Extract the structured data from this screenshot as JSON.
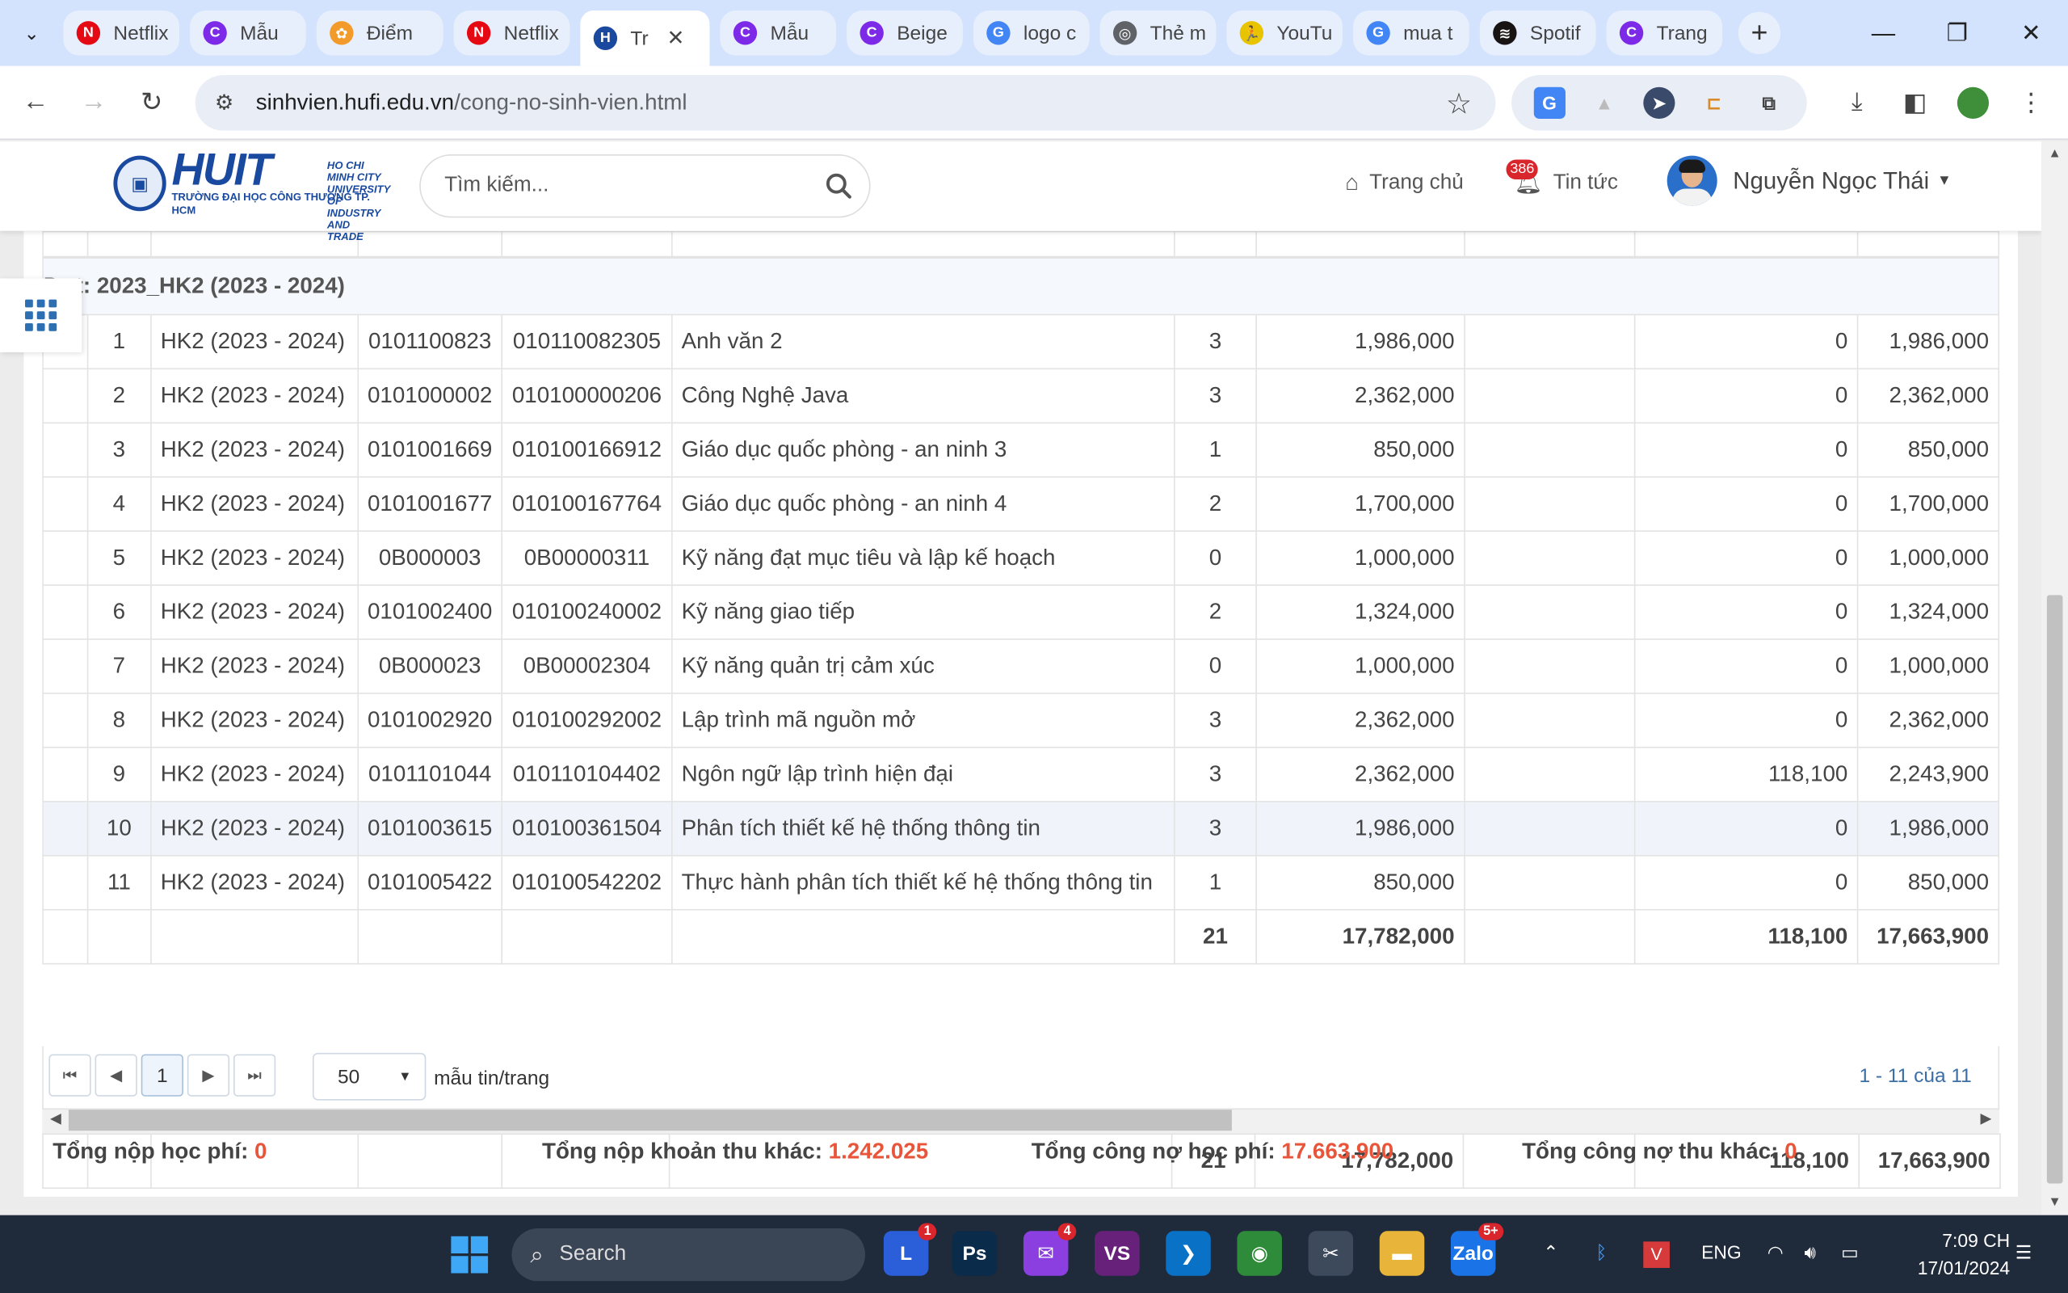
{
  "browser": {
    "tabs": [
      {
        "label": "Netflix",
        "icon": "netflix-icon",
        "color": "#e50914",
        "glyph": "N"
      },
      {
        "label": "Mẫu",
        "icon": "canva-icon",
        "color": "#7d2ae8",
        "glyph": "C"
      },
      {
        "label": "Điểm",
        "icon": "settings-flower-icon",
        "color": "#f29b2b",
        "glyph": "✿"
      },
      {
        "label": "Netflix",
        "icon": "netflix-icon",
        "color": "#e50914",
        "glyph": "N"
      },
      {
        "label": "Tr",
        "icon": "huit-icon",
        "color": "#1a4aa0",
        "glyph": "H",
        "active": true
      },
      {
        "label": "Mẫu",
        "icon": "canva-icon",
        "color": "#7d2ae8",
        "glyph": "C"
      },
      {
        "label": "Beige",
        "icon": "canva-icon",
        "color": "#7d2ae8",
        "glyph": "C"
      },
      {
        "label": "logo c",
        "icon": "google-icon",
        "color": "#4285f4",
        "glyph": "G"
      },
      {
        "label": "Thẻ m",
        "icon": "chrome-icon",
        "color": "#5f6368",
        "glyph": "◎"
      },
      {
        "label": "YouTu",
        "icon": "run-icon",
        "color": "#e8c300",
        "glyph": "🏃"
      },
      {
        "label": "mua t",
        "icon": "google-icon",
        "color": "#4285f4",
        "glyph": "G"
      },
      {
        "label": "Spotif",
        "icon": "spotify-icon",
        "color": "#191414",
        "glyph": "≋"
      },
      {
        "label": "Trang",
        "icon": "canva-icon",
        "color": "#7d2ae8",
        "glyph": "C"
      }
    ],
    "url_host": "sinhvien.hufi.edu.vn",
    "url_path": "/cong-no-sinh-vien.html"
  },
  "site": {
    "logo_text": "HUIT",
    "logo_sub": "TRƯỜNG ĐẠI HỌC CÔNG THƯƠNG TP. HCM",
    "logo_side": "HO CHI MINH CITY UNIVERSITY OF INDUSTRY AND TRADE",
    "search_placeholder": "Tìm kiếm...",
    "nav_home": "Trang chủ",
    "nav_news": "Tin tức",
    "news_badge": "386",
    "user_name": "Nguyễn Ngọc Thái"
  },
  "table": {
    "group_label": "Đợt: 2023_HK2 (2023 - 2024)",
    "rows": [
      {
        "stt": "1",
        "hk": "HK2 (2023 - 2024)",
        "ma_mh": "0101100823",
        "ma_lhp": "010110082305",
        "ten": "Anh văn 2",
        "tc": "3",
        "so_tien": "1,986,000",
        "mien_giam": "",
        "khau_tru": "0",
        "cong_no": "1,986,000"
      },
      {
        "stt": "2",
        "hk": "HK2 (2023 - 2024)",
        "ma_mh": "0101000002",
        "ma_lhp": "010100000206",
        "ten": "Công Nghệ Java",
        "tc": "3",
        "so_tien": "2,362,000",
        "mien_giam": "",
        "khau_tru": "0",
        "cong_no": "2,362,000"
      },
      {
        "stt": "3",
        "hk": "HK2 (2023 - 2024)",
        "ma_mh": "0101001669",
        "ma_lhp": "010100166912",
        "ten": "Giáo dục quốc phòng - an ninh 3",
        "tc": "1",
        "so_tien": "850,000",
        "mien_giam": "",
        "khau_tru": "0",
        "cong_no": "850,000"
      },
      {
        "stt": "4",
        "hk": "HK2 (2023 - 2024)",
        "ma_mh": "0101001677",
        "ma_lhp": "010100167764",
        "ten": "Giáo dục quốc phòng - an ninh 4",
        "tc": "2",
        "so_tien": "1,700,000",
        "mien_giam": "",
        "khau_tru": "0",
        "cong_no": "1,700,000"
      },
      {
        "stt": "5",
        "hk": "HK2 (2023 - 2024)",
        "ma_mh": "0B000003",
        "ma_lhp": "0B00000311",
        "ten": "Kỹ năng đạt mục tiêu và lập kế hoạch",
        "tc": "0",
        "so_tien": "1,000,000",
        "mien_giam": "",
        "khau_tru": "0",
        "cong_no": "1,000,000"
      },
      {
        "stt": "6",
        "hk": "HK2 (2023 - 2024)",
        "ma_mh": "0101002400",
        "ma_lhp": "010100240002",
        "ten": "Kỹ năng giao tiếp",
        "tc": "2",
        "so_tien": "1,324,000",
        "mien_giam": "",
        "khau_tru": "0",
        "cong_no": "1,324,000"
      },
      {
        "stt": "7",
        "hk": "HK2 (2023 - 2024)",
        "ma_mh": "0B000023",
        "ma_lhp": "0B00002304",
        "ten": "Kỹ năng quản trị cảm xúc",
        "tc": "0",
        "so_tien": "1,000,000",
        "mien_giam": "",
        "khau_tru": "0",
        "cong_no": "1,000,000"
      },
      {
        "stt": "8",
        "hk": "HK2 (2023 - 2024)",
        "ma_mh": "0101002920",
        "ma_lhp": "010100292002",
        "ten": "Lập trình mã nguồn mở",
        "tc": "3",
        "so_tien": "2,362,000",
        "mien_giam": "",
        "khau_tru": "0",
        "cong_no": "2,362,000"
      },
      {
        "stt": "9",
        "hk": "HK2 (2023 - 2024)",
        "ma_mh": "0101101044",
        "ma_lhp": "010110104402",
        "ten": "Ngôn ngữ lập trình hiện đại",
        "tc": "3",
        "so_tien": "2,362,000",
        "mien_giam": "",
        "khau_tru": "118,100",
        "cong_no": "2,243,900"
      },
      {
        "stt": "10",
        "hk": "HK2 (2023 - 2024)",
        "ma_mh": "0101003615",
        "ma_lhp": "010100361504",
        "ten": "Phân tích thiết kế hệ thống thông tin",
        "tc": "3",
        "so_tien": "1,986,000",
        "mien_giam": "",
        "khau_tru": "0",
        "cong_no": "1,986,000",
        "highlight": true
      },
      {
        "stt": "11",
        "hk": "HK2 (2023 - 2024)",
        "ma_mh": "0101005422",
        "ma_lhp": "010100542202",
        "ten": "Thực hành phân tích thiết kế hệ thống thông tin",
        "tc": "1",
        "so_tien": "850,000",
        "mien_giam": "",
        "khau_tru": "0",
        "cong_no": "850,000"
      }
    ],
    "group_total": {
      "tc": "21",
      "so_tien": "17,782,000",
      "khau_tru": "118,100",
      "cong_no": "17,663,900"
    },
    "grand_total": {
      "tc": "21",
      "so_tien": "17,782,000",
      "khau_tru": "118,100",
      "cong_no": "17,663,900"
    }
  },
  "pager": {
    "page": "1",
    "page_size": "50",
    "page_size_label": "mẫu tin/trang",
    "info": "1 - 11 của 11"
  },
  "summary": {
    "hoc_phi_label": "Tổng nộp học phí: ",
    "hoc_phi_value": "0",
    "thu_khac_label": "Tổng nộp khoản thu khác: ",
    "thu_khac_value": "1.242.025",
    "cong_no_hp_label": "Tổng công nợ học phí: ",
    "cong_no_hp_value": "17.663.900",
    "cong_no_khac_label": "Tổng công nợ thu khác: ",
    "cong_no_khac_value": "0"
  },
  "taskbar": {
    "search_label": "Search",
    "lang": "ENG",
    "time": "7:09 CH",
    "date": "17/01/2024",
    "apps": [
      {
        "name": "teams-icon",
        "glyph": "L",
        "color": "#2b5fd9",
        "badge": "1"
      },
      {
        "name": "photoshop-icon",
        "glyph": "Ps",
        "color": "#0b2b4a",
        "badge": ""
      },
      {
        "name": "messenger-icon",
        "glyph": "✉",
        "color": "#8b3fe0",
        "badge": "4"
      },
      {
        "name": "visual-studio-icon",
        "glyph": "VS",
        "color": "#68217a",
        "badge": ""
      },
      {
        "name": "vscode-icon",
        "glyph": "❯",
        "color": "#0a72c6",
        "badge": ""
      },
      {
        "name": "chrome-icon",
        "glyph": "◉",
        "color": "#2e8b3a",
        "badge": ""
      },
      {
        "name": "snipping-tool-icon",
        "glyph": "✂",
        "color": "#3d4a5c",
        "badge": ""
      },
      {
        "name": "file-explorer-icon",
        "glyph": "▬",
        "color": "#e8b43a",
        "badge": ""
      },
      {
        "name": "zalo-icon",
        "glyph": "Zalo",
        "color": "#1a74e8",
        "badge": "5+"
      }
    ]
  }
}
